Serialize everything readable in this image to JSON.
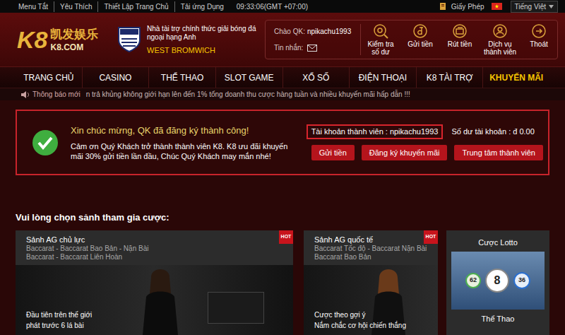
{
  "top_bar": {
    "links": [
      "Menu Tắt",
      "Yêu Thích",
      "Thiết Lập Trang Chủ",
      "Tải ứng Dụng"
    ],
    "clock": "09:33:06(GMT +07:00)",
    "license": "Giấy Phép",
    "language": "Tiếng Việt"
  },
  "header": {
    "logo": {
      "mark": "K8",
      "chinese": "凯发娱乐",
      "domain": "K8.COM"
    },
    "sponsor": {
      "line1": "Nhà tài trợ chính thức giải bóng đá",
      "line2": "ngoại hạng Anh",
      "club": "WEST BROMWICH"
    },
    "greeting_label": "Chào QK:",
    "username": "npikachu1993",
    "messages_label": "Tin nhắn:",
    "actions": [
      {
        "lines": [
          "Kiểm tra",
          "số dư"
        ]
      },
      {
        "lines": [
          "Gửi tiền"
        ]
      },
      {
        "lines": [
          "Rút tiền"
        ]
      },
      {
        "lines": [
          "Dịch vụ",
          "thành viên"
        ]
      },
      {
        "lines": [
          "Thoát"
        ]
      }
    ]
  },
  "nav": {
    "items": [
      {
        "label": "TRANG CHỦ",
        "selected": false
      },
      {
        "label": "CASINO",
        "selected": false
      },
      {
        "label": "THỂ THAO",
        "selected": false
      },
      {
        "label": "SLOT GAME",
        "selected": false
      },
      {
        "label": "XỔ SỐ",
        "selected": false
      },
      {
        "label": "ĐIỆN THOẠI",
        "selected": false
      },
      {
        "label": "K8 TÀI TRỢ",
        "selected": false
      },
      {
        "label": "KHUYẾN MÃI",
        "selected": true
      }
    ]
  },
  "announcement": {
    "label": "Thông báo mới",
    "text": "n trả khủng không giới hạn lên đến 1% tổng doanh thu cược hàng tuần và nhiều khuyến mãi hấp dẫn !!!"
  },
  "success": {
    "title": "Xin chúc mừng, QK đã đăng ký thành công!",
    "message_lines": [
      "Cảm ơn Quý Khách trở thành thành viên K8. K8 ưu đãi khuyến",
      "mãi 30% gửi tiền lần đầu, Chúc Quý Khách may mắn nhé!"
    ],
    "account_label": "Tài khoản thành viên :",
    "account": "npikachu1993",
    "balance_label": "Số dư tài khoản :",
    "balance": "đ 0.00",
    "buttons": [
      "Gửi tiền",
      "Đăng ký khuyến mãi",
      "Trung tâm thành viên"
    ]
  },
  "lobby": {
    "heading": "Vui lòng chọn sảnh tham gia cược:",
    "cards": [
      {
        "title": "Sảnh AG chủ lực",
        "badge": "HOT",
        "games": [
          "Baccarat - Baccarat Bao Bản - Nặn Bài",
          "Baccarat - Baccarat Liên Hoàn"
        ],
        "promo": [
          "Đầu tiên trên thế giới",
          "phát trước 6 lá bài"
        ]
      },
      {
        "title": "Sảnh AG quốc tế",
        "badge": "HOT",
        "games": [
          "Baccarat Tốc độ - Baccarat Nặn Bài",
          "Baccarat Bao Bản"
        ],
        "promo": [
          "Cược theo gợi ý",
          "Nắm chắc cơ hội chiến thắng"
        ]
      }
    ],
    "side": {
      "lotto_title": "Cược Lotto",
      "balls": [
        "62",
        "8",
        "36"
      ],
      "sports_title": "Thể Thao"
    }
  }
}
